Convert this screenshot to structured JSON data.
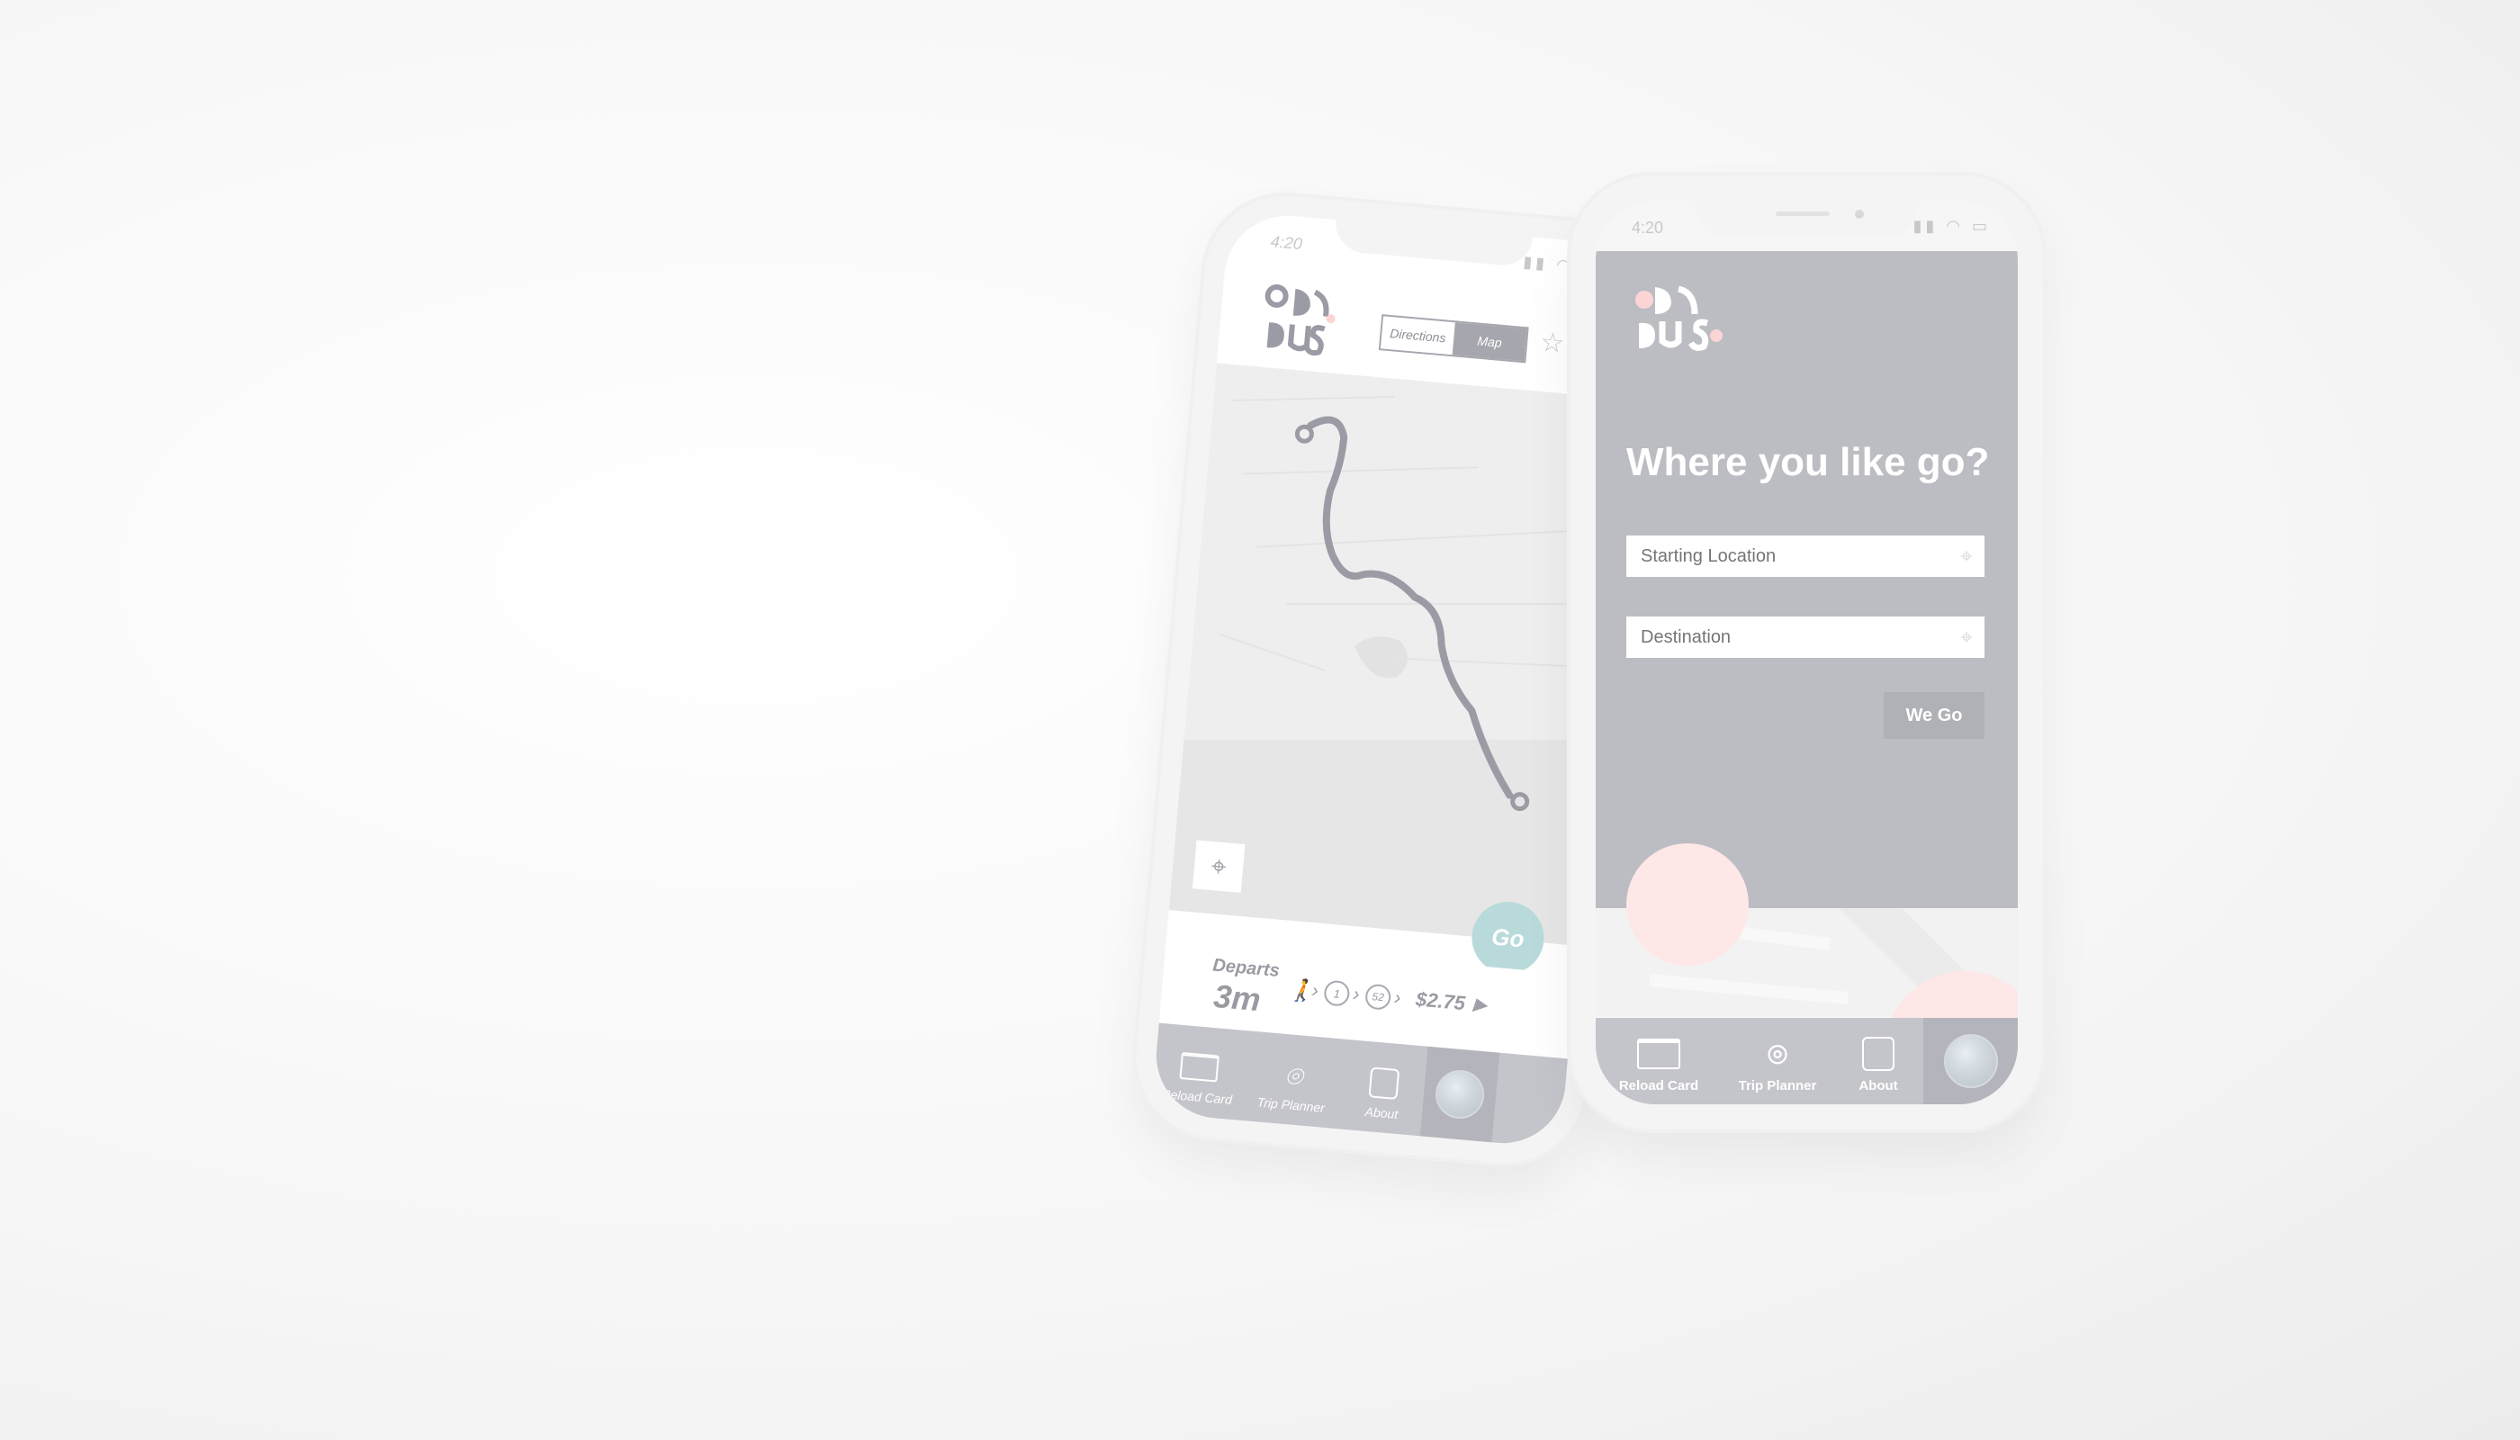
{
  "map_phone": {
    "status_time": "4:20",
    "segmented": {
      "directions_label": "Directions",
      "map_label": "Map"
    },
    "go_button_label": "Go",
    "departs_label": "Departs",
    "departs_time": "3m",
    "route_steps": [
      "1",
      "52"
    ],
    "fare": "$2.75",
    "tabs": [
      {
        "label": "Reload Card",
        "icon": "card-icon"
      },
      {
        "label": "Trip Planner",
        "icon": "location-pin-icon"
      },
      {
        "label": "About",
        "icon": "bus-icon"
      }
    ],
    "route_color": "#9b9ba5",
    "go_color": "#b9dadb"
  },
  "planner_phone": {
    "status_time": "4:20",
    "heading": "Where you like go?",
    "starting_location": {
      "placeholder": "Starting Location",
      "value": ""
    },
    "destination": {
      "placeholder": "Destination",
      "value": ""
    },
    "we_go_label": "We Go",
    "tabs": [
      {
        "label": "Reload Card",
        "icon": "card-icon"
      },
      {
        "label": "Trip Planner",
        "icon": "location-pin-icon"
      },
      {
        "label": "About",
        "icon": "bus-icon"
      }
    ],
    "panel_color": "#bcbcc3",
    "accent_pink": "#fde7e7"
  }
}
